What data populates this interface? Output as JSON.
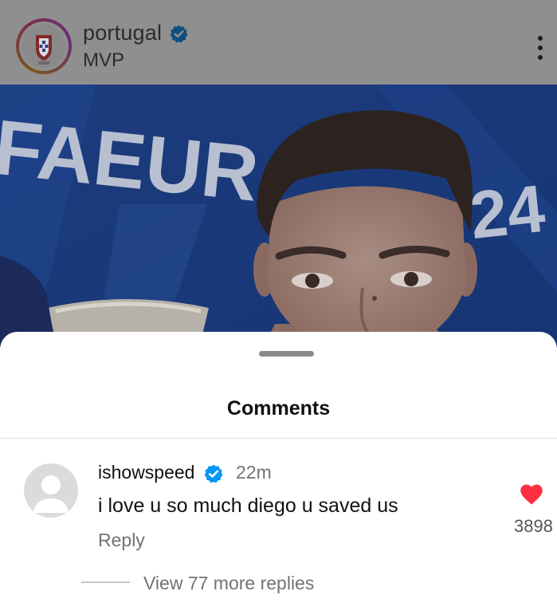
{
  "post": {
    "username": "portugal",
    "subtitle": "MVP",
    "icons": {
      "avatar": "portugal-crest-icon",
      "verified": "verified-badge-icon",
      "more": "more-vertical-icon"
    }
  },
  "photo": {
    "backdrop_text_left": "FAEUR",
    "backdrop_text_right": "24"
  },
  "sheet": {
    "title": "Comments"
  },
  "comments": [
    {
      "username": "ishowspeed",
      "verified": true,
      "time": "22m",
      "text": "i love u so much diego u saved us",
      "reply_label": "Reply",
      "liked": true,
      "like_count": "3898",
      "view_replies_label": "View 77 more replies"
    }
  ],
  "colors": {
    "verified": "#0095f6",
    "like": "#ff3040",
    "secondary_text": "#737373",
    "dim_overlay": "#8f8f8f"
  }
}
